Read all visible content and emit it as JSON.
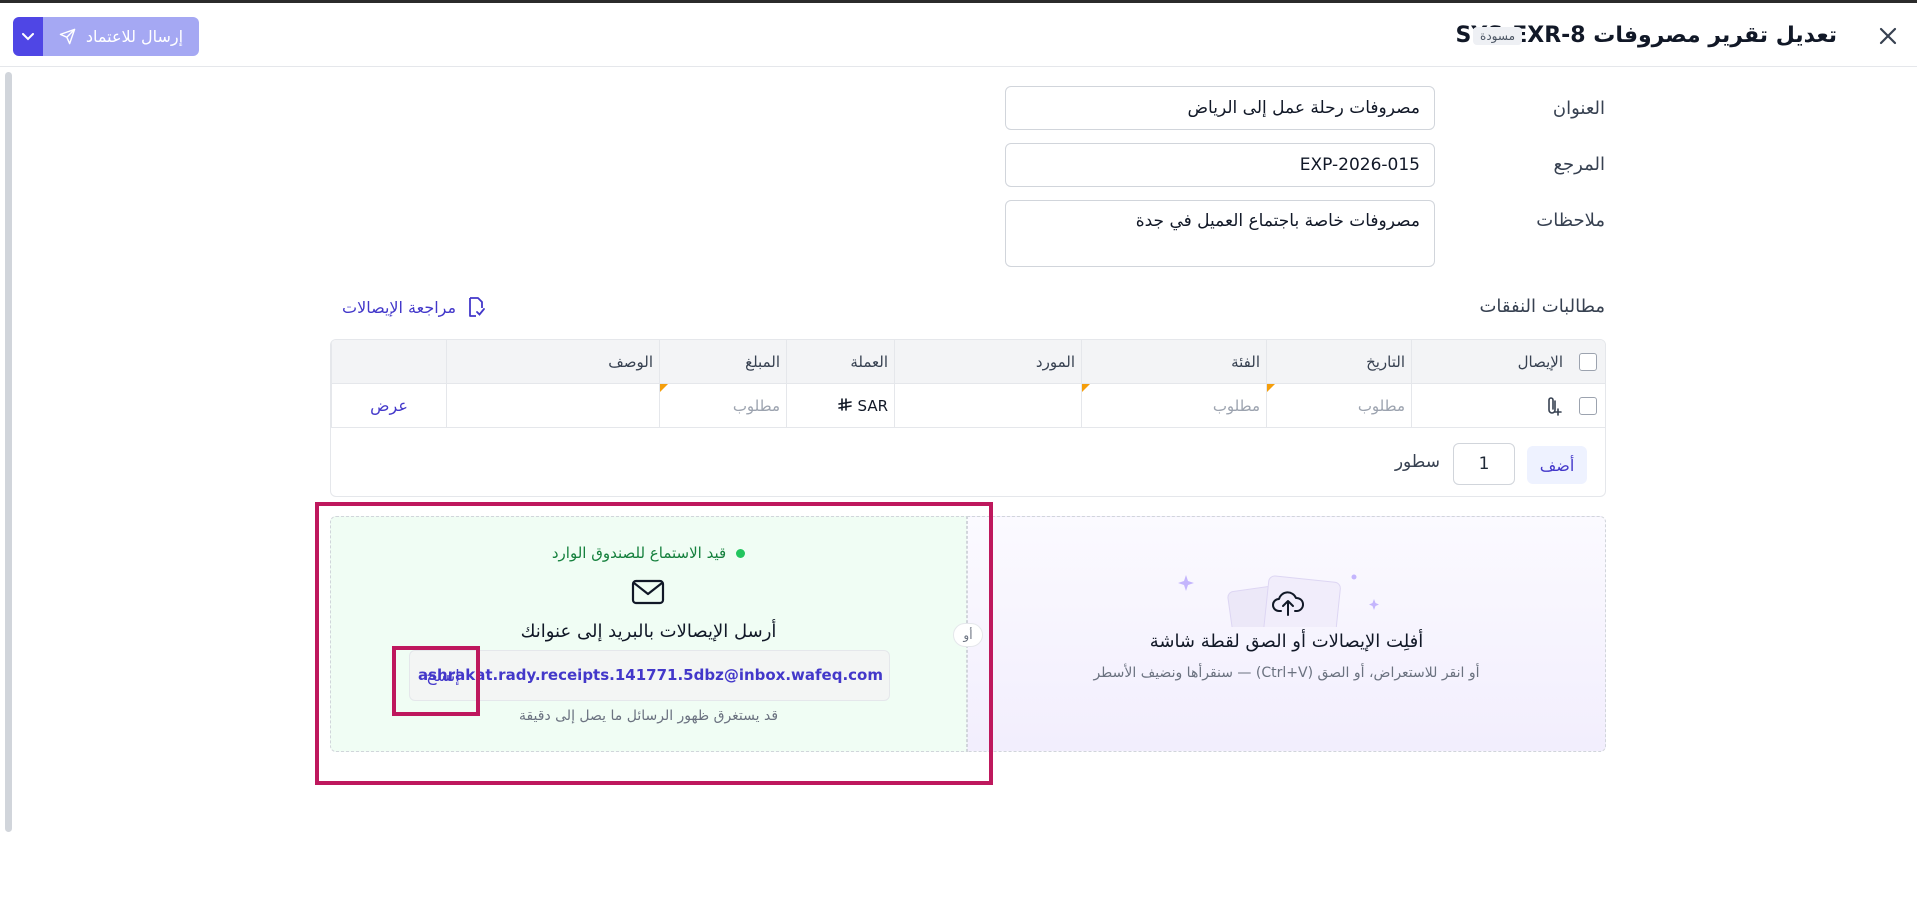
{
  "header": {
    "title": "تعديل تقرير مصروفات SYS-EXR-8",
    "status_badge": "مسودة",
    "submit_label": "إرسال للاعتماد"
  },
  "form": {
    "title_label": "العنوان",
    "title_value": "مصروفات رحلة عمل إلى الرياض",
    "reference_label": "المرجع",
    "reference_value": "EXP-2026-015",
    "notes_label": "ملاحظات",
    "notes_value": "مصروفات خاصة باجتماع العميل في جدة"
  },
  "claims": {
    "section_title": "مطالبات النفقات",
    "review_link": "مراجعة الإيصالات",
    "columns": {
      "receipt": "الإيصال",
      "date": "التاريخ",
      "category": "الفئة",
      "vendor": "المورد",
      "currency": "العملة",
      "amount": "المبلغ",
      "description": "الوصف"
    },
    "row": {
      "date": "مطلوب",
      "category": "مطلوب",
      "currency": "SAR",
      "amount": "مطلوب",
      "action": "عرض"
    },
    "add_button": "أضف",
    "rows_count": "1",
    "rows_label": "سطور"
  },
  "upload": {
    "drop_title": "أفلِت الإيصالات أو الصق لقطة شاشة",
    "drop_subtitle": "أو انقر للاستعراض، أو الصق (Ctrl+V) — سنقرأها ونضيف الأسطر",
    "or_label": "أو",
    "listening_status": "قيد الاستماع للصندوق الوارد",
    "email_title": "أرسل الإيصالات بالبريد إلى عنوانك",
    "inbox_address": "ashrakat.rady.receipts.141771.5dbz@inbox.wafeq.com",
    "copy_button": "إنسخ",
    "delay_note": "قد يستغرق ظهور الرسائل ما يصل إلى دقيقة"
  },
  "colors": {
    "accent": "#4f46e5",
    "link": "#4338ca",
    "highlight": "#be185d",
    "success": "#22c55e",
    "required_flag": "#f59e0b"
  }
}
